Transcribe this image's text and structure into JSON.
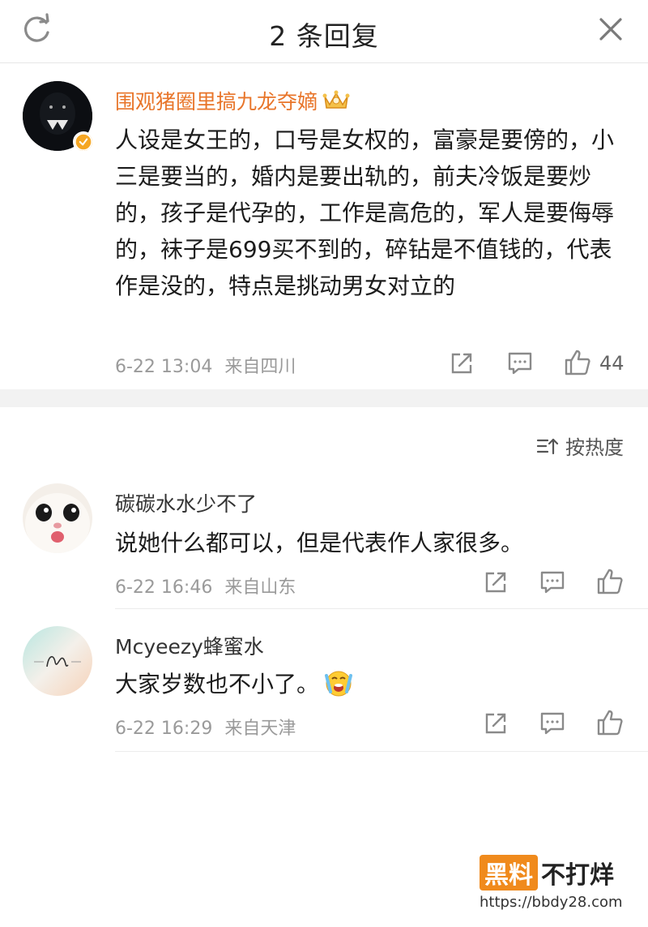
{
  "header": {
    "title": "2 条回复",
    "refresh_icon": "refresh-icon",
    "close_icon": "close-icon"
  },
  "main_comment": {
    "username": "围观猪圈里搞九龙夺嫡",
    "badge_icon": "crown-icon",
    "verified_icon": "verified-badge-icon",
    "content": "人设是女王的，口号是女权的，富豪是要傍的，小三是要当的，婚内是要出轨的，前夫冷饭是要炒的，孩子是代孕的，工作是高危的，军人是要侮辱的，袜子是699买不到的，碎钻是不值钱的，代表作是没的，特点是挑动男女对立的",
    "time": "6-22 13:04",
    "location": "来自四川",
    "like_count": "44"
  },
  "sort": {
    "label": "按热度",
    "icon": "sort-icon"
  },
  "replies": [
    {
      "username": "碳碳水水少不了",
      "content": "说她什么都可以，但是代表作人家很多。",
      "time": "6-22 16:46",
      "location": "来自山东"
    },
    {
      "username": "Mcyeezy蜂蜜水",
      "content": "大家岁数也不小了。",
      "emoji_icon": "crying-emoji-icon",
      "time": "6-22 16:29",
      "location": "来自天津"
    }
  ],
  "watermark": {
    "brand_box": "黑料",
    "brand_text": "不打烊",
    "url": "https://bbdy28.com"
  },
  "colors": {
    "username_accent": "#e8752a",
    "verified": "#f5a623",
    "meta_text": "#9a9a9a",
    "band": "#f2f2f2"
  }
}
